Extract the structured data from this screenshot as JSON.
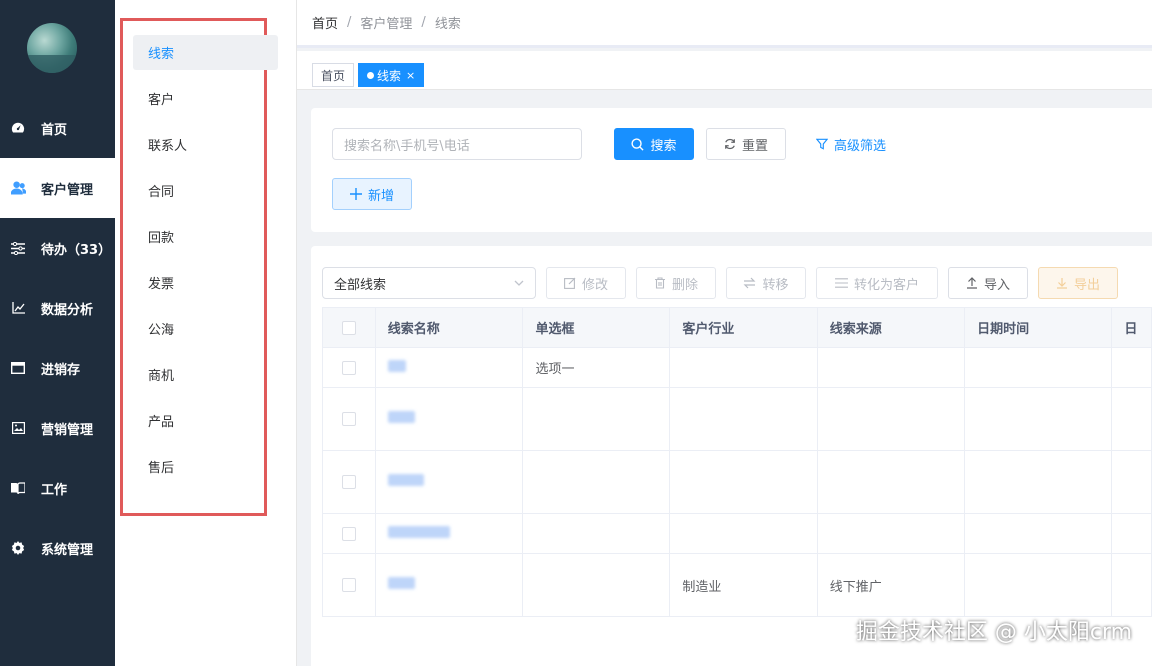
{
  "nav": {
    "items": [
      {
        "label": "首页",
        "icon": "dashboard-icon"
      },
      {
        "label": "客户管理",
        "icon": "users-icon"
      },
      {
        "label": "待办（33）",
        "icon": "sliders-icon"
      },
      {
        "label": "数据分析",
        "icon": "chart-icon"
      },
      {
        "label": "进销存",
        "icon": "window-icon"
      },
      {
        "label": "营销管理",
        "icon": "image-icon"
      },
      {
        "label": "工作",
        "icon": "book-icon"
      },
      {
        "label": "系统管理",
        "icon": "gear-icon"
      }
    ],
    "active": "客户管理"
  },
  "submenu": {
    "items": [
      "线索",
      "客户",
      "联系人",
      "合同",
      "回款",
      "发票",
      "公海",
      "商机",
      "产品",
      "售后"
    ],
    "active": "线索"
  },
  "breadcrumb": [
    "首页",
    "客户管理",
    "线索"
  ],
  "tags": [
    {
      "label": "首页"
    },
    {
      "label": "线索",
      "close": "×"
    }
  ],
  "search": {
    "placeholder": "搜索名称\\手机号\\电话",
    "search_label": "搜索",
    "reset_label": "重置",
    "advanced_label": "高级筛选",
    "add_label": "新增"
  },
  "toolbar": {
    "filter_value": "全部线索",
    "edit_label": "修改",
    "delete_label": "删除",
    "transfer_label": "转移",
    "convert_label": "转化为客户",
    "import_label": "导入",
    "export_label": "导出"
  },
  "table": {
    "columns": [
      "线索名称",
      "单选框",
      "客户行业",
      "线索来源",
      "日期时间",
      "日"
    ],
    "rows": [
      {
        "name": "",
        "radio": "选项一",
        "industry": "",
        "source": "",
        "date": ""
      },
      {
        "name": "",
        "radio": "",
        "industry": "",
        "source": "",
        "date": ""
      },
      {
        "name": "",
        "radio": "",
        "industry": "",
        "source": "",
        "date": ""
      },
      {
        "name": "",
        "radio": "",
        "industry": "",
        "source": "",
        "date": ""
      },
      {
        "name": "",
        "radio": "",
        "industry": "制造业",
        "source": "线下推广",
        "date": ""
      }
    ]
  },
  "watermark": "掘金技术社区 @ 小太阳crm",
  "colors": {
    "nav_bg": "#1f2d3d",
    "primary": "#1890ff",
    "highlight_frame": "#e05a5a"
  }
}
